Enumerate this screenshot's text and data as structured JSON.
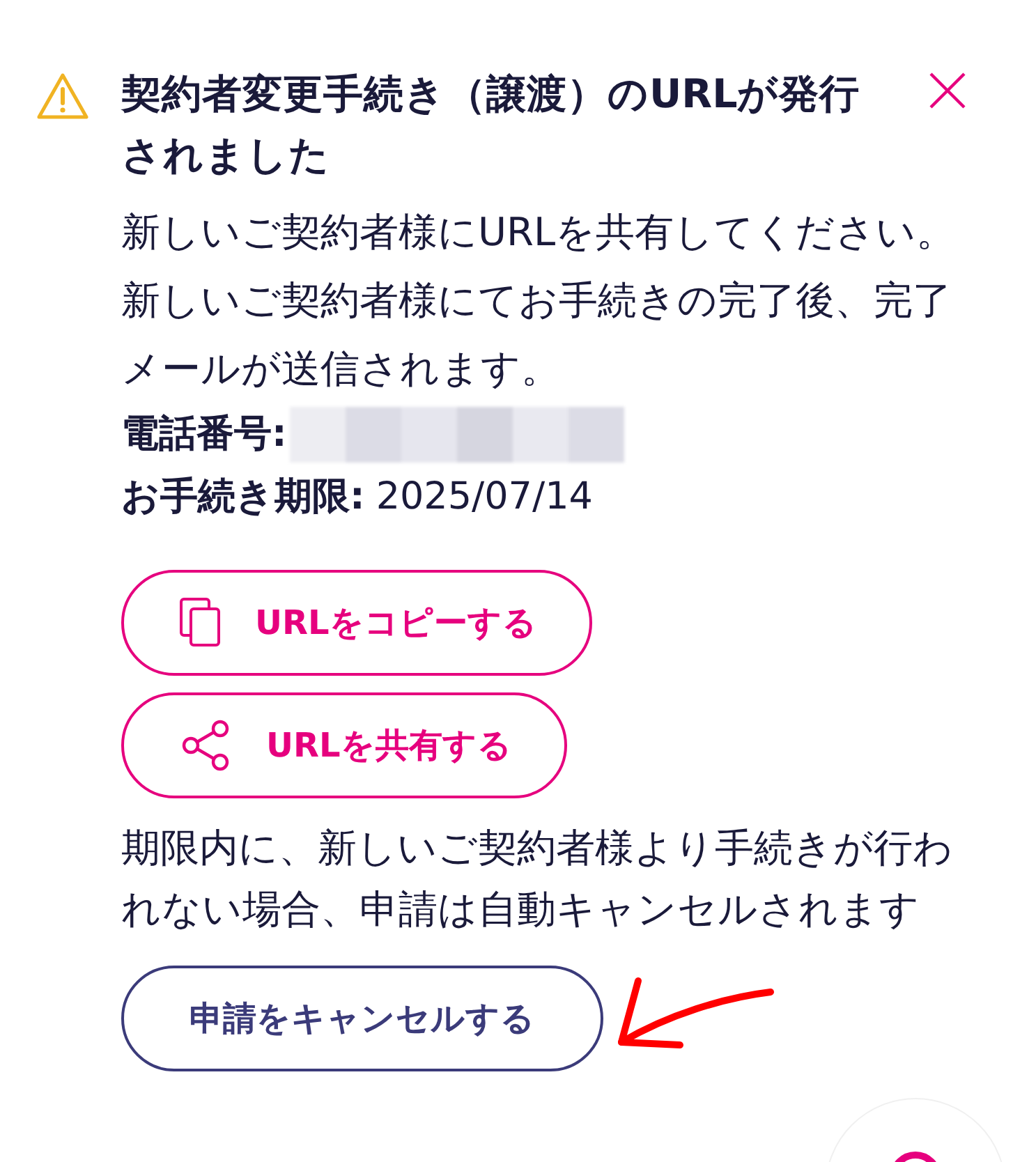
{
  "alert": {
    "title": "契約者変更手続き（譲渡）のURLが発行されました",
    "message": "新しいご契約者様にURLを共有してください。新しいご契約者様にてお手続きの完了後、完了メールが送信されます。",
    "fields": [
      {
        "kind": "redacted",
        "label": "電話番号:"
      },
      {
        "kind": "text",
        "label": "お手続き期限:",
        "value": "2025/07/14"
      }
    ],
    "actions": [
      {
        "kind": "copy",
        "label": "URLをコピーする"
      },
      {
        "kind": "share",
        "label": "URLを共有する"
      }
    ],
    "notice": "期限内に、新しいご契約者様より手続きが行われない場合、申請は自動キャンセルされます",
    "cancel_button": {
      "label": "申請をキャンセルする"
    }
  }
}
